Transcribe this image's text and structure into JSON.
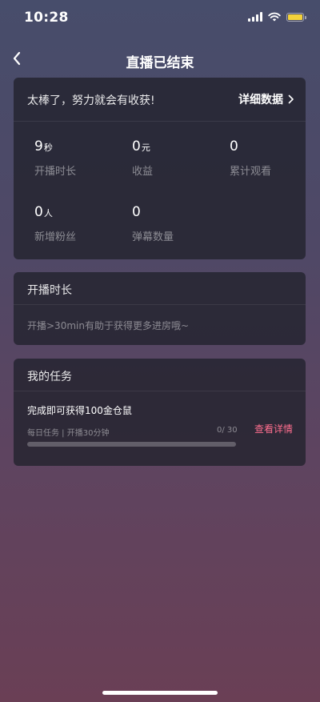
{
  "status_bar": {
    "time": "10:28"
  },
  "nav": {
    "title": "直播已结束"
  },
  "summary": {
    "message": "太棒了，努力就会有收获!",
    "detail_link": "详细数据",
    "stats": [
      {
        "value": "9",
        "unit": "秒",
        "label": "开播时长"
      },
      {
        "value": "0",
        "unit": "元",
        "label": "收益"
      },
      {
        "value": "0",
        "unit": "",
        "label": "累计观看"
      },
      {
        "value": "0",
        "unit": "人",
        "label": "新增粉丝"
      },
      {
        "value": "0",
        "unit": "",
        "label": "弹幕数量"
      }
    ]
  },
  "duration_section": {
    "title": "开播时长",
    "tip": "开播>30min有助于获得更多进房哦~"
  },
  "tasks_section": {
    "title": "我的任务",
    "task": {
      "name": "完成即可获得100金仓鼠",
      "subtitle": "每日任务 | 开播30分钟",
      "progress_text": "0/ 30",
      "progress": 0,
      "action": "查看详情"
    }
  },
  "colors": {
    "accent": "#ff6f8f",
    "battery": "#f3d13a"
  }
}
